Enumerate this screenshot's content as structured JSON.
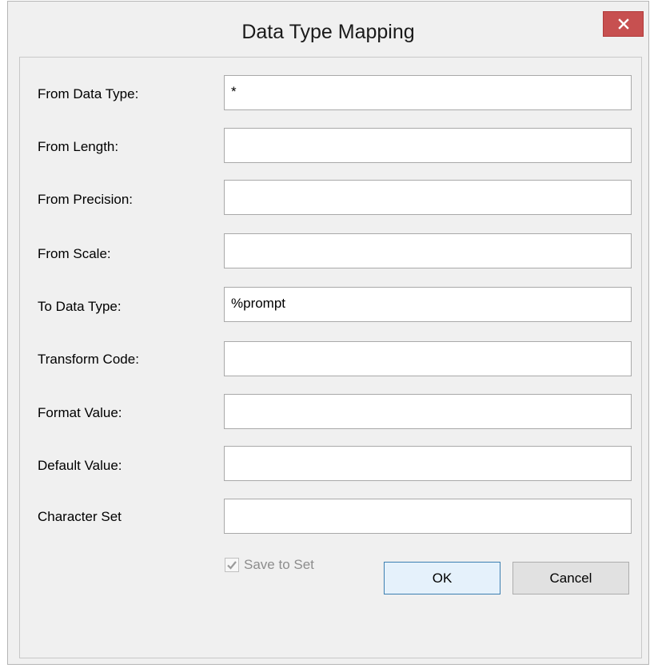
{
  "window": {
    "title": "Data Type Mapping",
    "close_icon": "close-icon"
  },
  "form": {
    "fields": [
      {
        "label": "From Data Type:",
        "value": "*"
      },
      {
        "label": "From Length:",
        "value": ""
      },
      {
        "label": "From Precision:",
        "value": ""
      },
      {
        "label": "From Scale:",
        "value": ""
      },
      {
        "label": "To Data Type:",
        "value": "%prompt"
      },
      {
        "label": "Transform Code:",
        "value": ""
      },
      {
        "label": "Format Value:",
        "value": ""
      },
      {
        "label": "Default Value:",
        "value": ""
      },
      {
        "label": "Character Set",
        "value": ""
      }
    ],
    "save_to_set": {
      "label": "Save to Set",
      "checked": true,
      "enabled": false
    }
  },
  "buttons": {
    "ok_label": "OK",
    "cancel_label": "Cancel"
  },
  "colors": {
    "close_button": "#c75050",
    "ok_border": "#3c7fb1",
    "disabled_text": "#8d8d8d"
  }
}
